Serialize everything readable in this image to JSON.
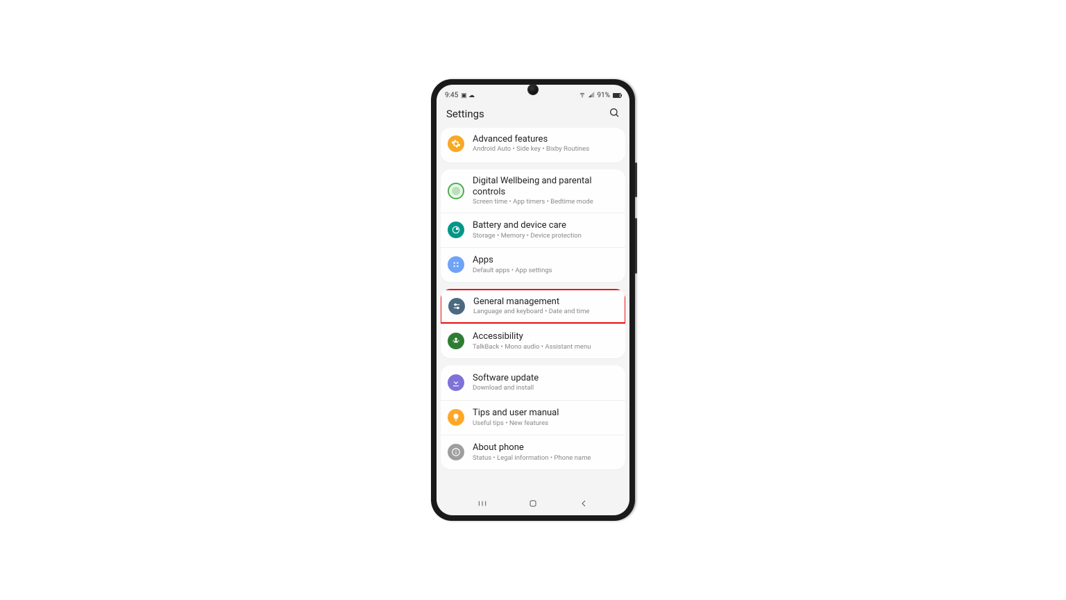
{
  "statusbar": {
    "time": "9:45",
    "left_icons": "▣ ☁",
    "right_signal": "📶",
    "battery_percent": "91%"
  },
  "header": {
    "title": "Settings"
  },
  "groups": [
    {
      "items": [
        {
          "id": "advanced-features",
          "icon": "gear",
          "color": "ic-orange",
          "title": "Advanced features",
          "subtitle": "Android Auto  •  Side key  •  Bixby Routines"
        }
      ]
    },
    {
      "items": [
        {
          "id": "digital-wellbeing",
          "icon": "ring",
          "color": "ic-green-ring",
          "title": "Digital Wellbeing and parental controls",
          "subtitle": "Screen time  •  App timers  •  Bedtime mode"
        },
        {
          "id": "battery",
          "icon": "care",
          "color": "ic-teal",
          "title": "Battery and device care",
          "subtitle": "Storage  •  Memory  •  Device protection"
        },
        {
          "id": "apps",
          "icon": "grid",
          "color": "ic-blue",
          "title": "Apps",
          "subtitle": "Default apps  •  App settings"
        }
      ]
    },
    {
      "items": [
        {
          "id": "general-management",
          "icon": "sliders",
          "color": "ic-bluegray",
          "title": "General management",
          "subtitle": "Language and keyboard  •  Date and time",
          "highlight": true
        },
        {
          "id": "accessibility",
          "icon": "person",
          "color": "ic-green",
          "title": "Accessibility",
          "subtitle": "TalkBack  •  Mono audio  •  Assistant menu"
        }
      ]
    },
    {
      "items": [
        {
          "id": "software-update",
          "icon": "download",
          "color": "ic-purple",
          "title": "Software update",
          "subtitle": "Download and install"
        },
        {
          "id": "tips",
          "icon": "bulb",
          "color": "ic-orange2",
          "title": "Tips and user manual",
          "subtitle": "Useful tips  •  New features"
        },
        {
          "id": "about-phone",
          "icon": "info",
          "color": "ic-gray",
          "title": "About phone",
          "subtitle": "Status  •  Legal information  •  Phone name"
        }
      ]
    }
  ]
}
